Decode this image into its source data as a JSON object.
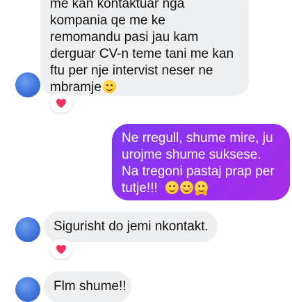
{
  "messages": [
    {
      "direction": "incoming",
      "lines": [
        "me kan kontaktuar nga",
        "kompania qe me ke",
        "remomandu pasi jau kam",
        "derguar CV-n teme tani me kan",
        "ftu per nje intervist neser ne",
        "mbramje"
      ],
      "reaction": "heart"
    },
    {
      "direction": "outgoing",
      "lines": [
        "Ne rregull, shume mire, ju",
        "urojme shume suksese.",
        "Na tregoni pastaj prap per",
        "tutje!!!"
      ]
    },
    {
      "direction": "incoming",
      "lines": [
        "Sigurisht do jemi nkontakt."
      ],
      "reaction": "heart"
    },
    {
      "direction": "incoming",
      "lines": [
        "Flm shume!!"
      ]
    }
  ],
  "icons": {
    "avatar": "avatar-circle",
    "reaction": "heart-icon",
    "emoji_smile": "smiling-face-icon",
    "emoji_blush": "smiling-face-with-smiling-eyes-icon",
    "emoji_hug": "hugging-face-icon"
  },
  "colors": {
    "incoming_bubble": "#eeeff1",
    "outgoing_bubble": "#9a2ef0",
    "heart": "#f0325c",
    "avatar": "#3f74d8"
  }
}
